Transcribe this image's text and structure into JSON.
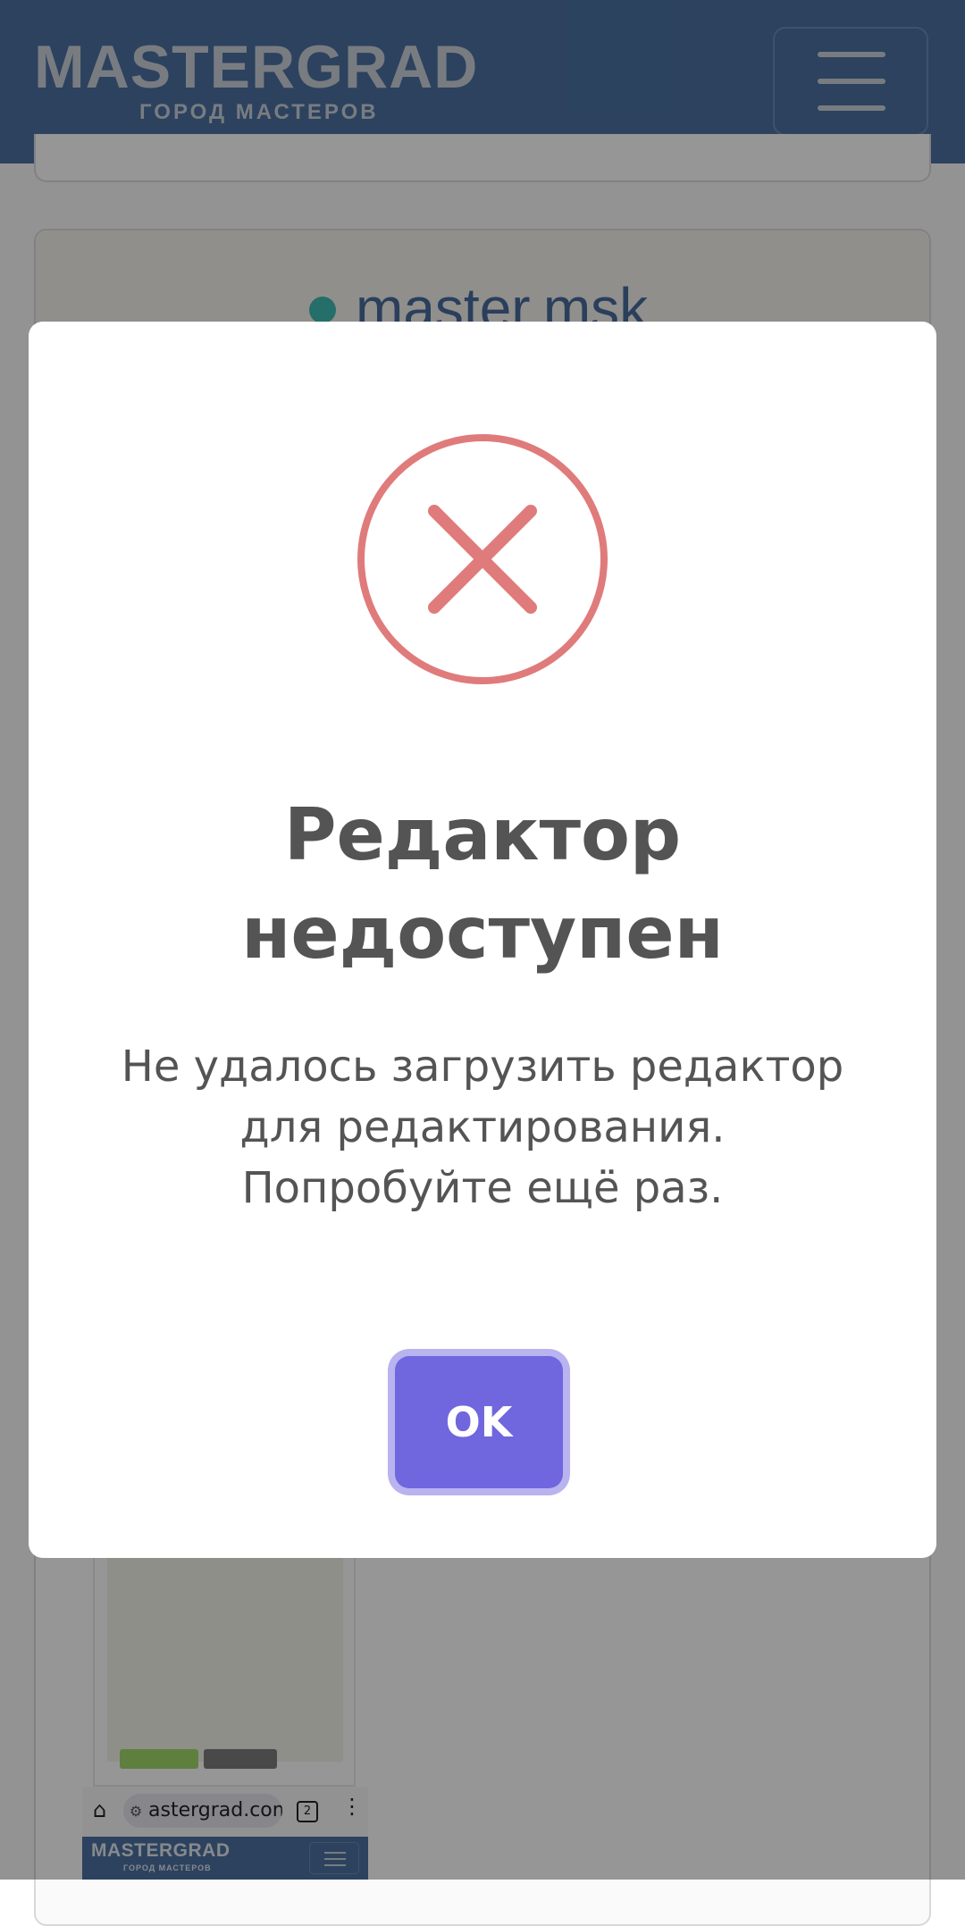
{
  "header": {
    "logo_main": "MASTERGRAD",
    "logo_sub": "ГОРОД МАСТЕРОВ",
    "menu_icon": "hamburger-icon"
  },
  "profile": {
    "username": "master.msk",
    "status_color": "#3fb8b0"
  },
  "mini_browser": {
    "home_icon": "⌂",
    "url": "astergrad.com",
    "tab_count": "2",
    "more_icon": "⋮",
    "logo_main": "MASTERGRAD",
    "logo_sub": "ГОРОД МАСТЕРОВ"
  },
  "modal": {
    "icon": "error-x-icon",
    "icon_color": "#e07b7b",
    "title": "Редактор недоступен",
    "text": "Не удалось загрузить редактор для редактирования. Попробуйте ещё раз.",
    "ok_label": "OK",
    "button_color": "#7066de"
  }
}
